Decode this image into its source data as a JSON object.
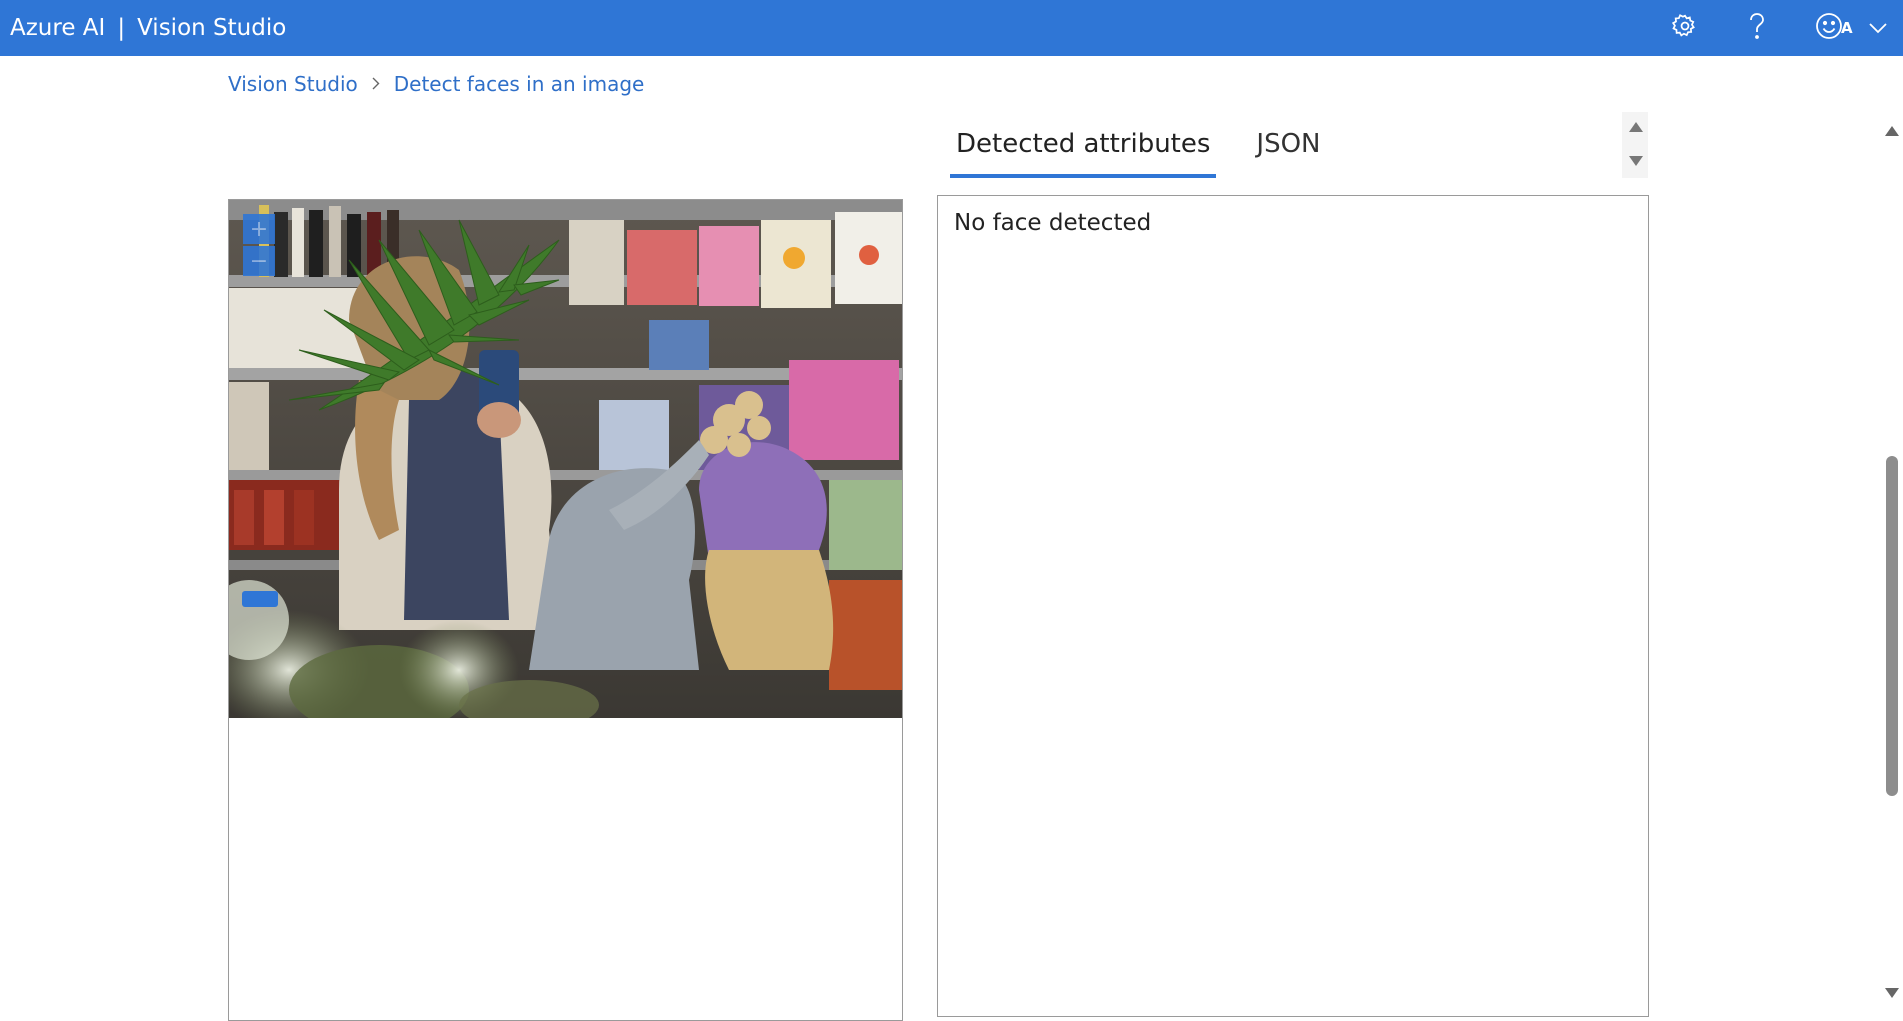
{
  "header": {
    "brand_left": "Azure AI",
    "brand_sep": "|",
    "brand_right": "Vision Studio",
    "avatar_initial": "A",
    "bg_color": "#2f76d6"
  },
  "breadcrumb": {
    "home": "Vision Studio",
    "current": "Detect faces in an image"
  },
  "tabs": [
    {
      "label": "Detected attributes",
      "active": true
    },
    {
      "label": "JSON",
      "active": false
    }
  ],
  "image_viewer": {
    "zoom_in": "+",
    "zoom_out": "−"
  },
  "results": {
    "message": "No face detected"
  }
}
